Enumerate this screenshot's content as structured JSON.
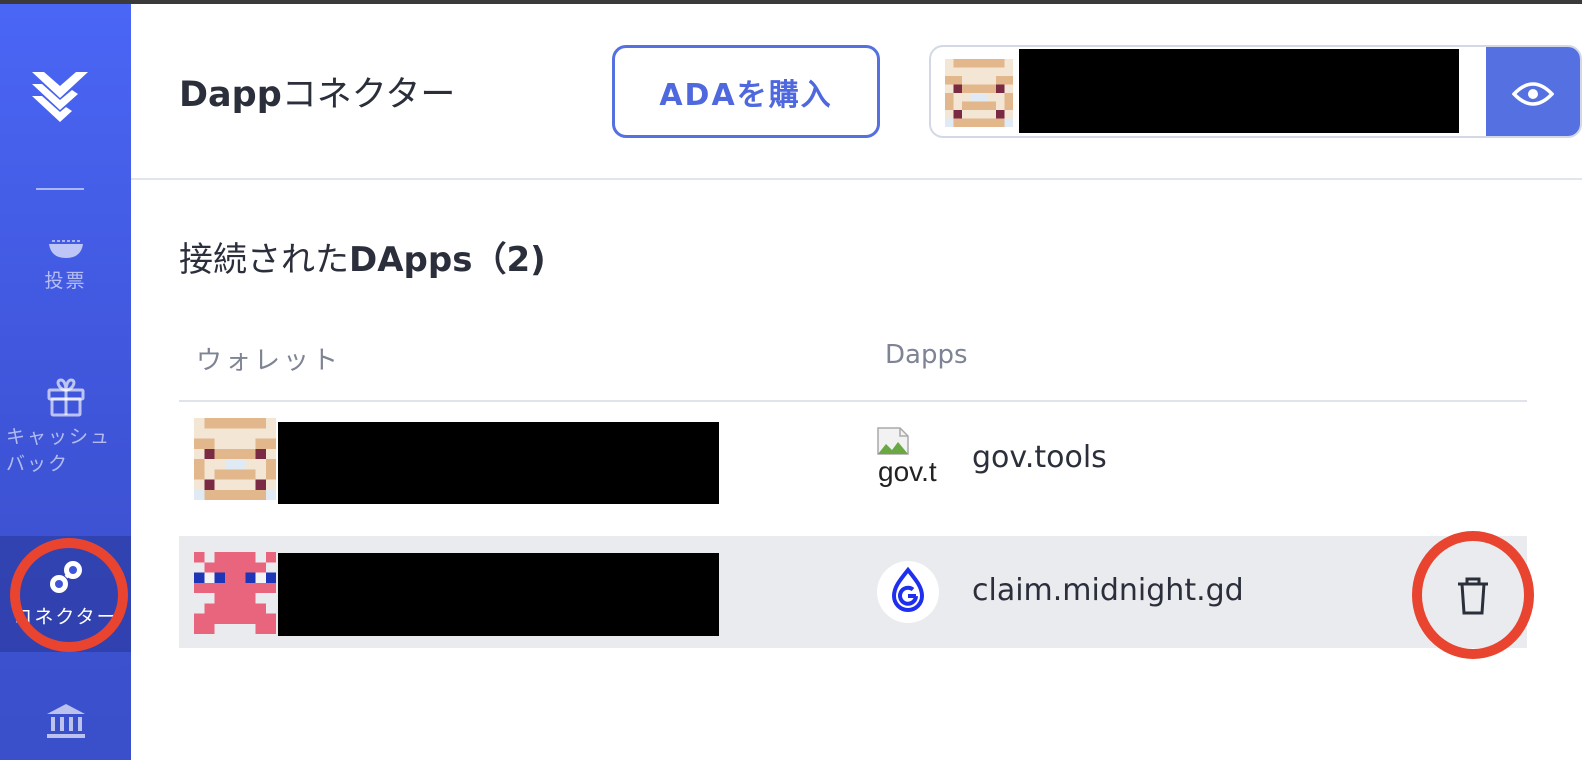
{
  "colors": {
    "accent": "#5570e0",
    "sidebar": "#4a66f5",
    "highlight": "#e8442f"
  },
  "sidebar": {
    "logo_icon": "yoroi-logo-icon",
    "items": [
      {
        "label": "投票",
        "icon": "vote-bowl-icon"
      },
      {
        "label": "キャッシュバック",
        "label_line1": "キャッシュ",
        "label_line2": "バック",
        "icon": "gift-icon"
      },
      {
        "label": "コネクター",
        "icon": "connector-icon",
        "active": true
      },
      {
        "label": "",
        "icon": "bank-icon"
      }
    ]
  },
  "header": {
    "title_bold": "Dapp",
    "title_rest": "コネクター",
    "buy_button": "ADAを購入",
    "eye_icon": "eye-icon"
  },
  "main": {
    "section_title_prefix": "接続された",
    "section_title_bold": "DApps（2)",
    "columns": [
      "ウォレット",
      "Dapps"
    ],
    "rows": [
      {
        "dapp": "gov.tools",
        "icon_text": "gov.t",
        "active": false
      },
      {
        "dapp": "claim.midnight.gd",
        "active": true,
        "delete_icon": "trash-icon"
      }
    ]
  }
}
